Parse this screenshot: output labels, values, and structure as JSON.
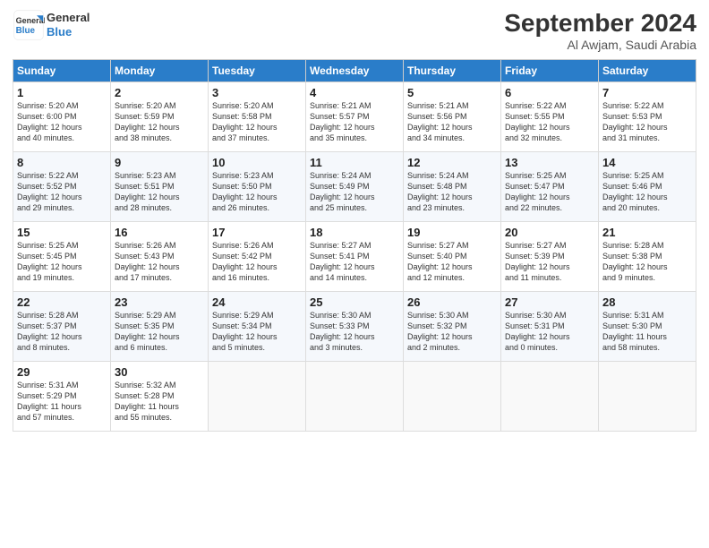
{
  "header": {
    "logo_line1": "General",
    "logo_line2": "Blue",
    "month": "September 2024",
    "location": "Al Awjam, Saudi Arabia"
  },
  "days_of_week": [
    "Sunday",
    "Monday",
    "Tuesday",
    "Wednesday",
    "Thursday",
    "Friday",
    "Saturday"
  ],
  "weeks": [
    [
      {
        "num": "1",
        "lines": [
          "Sunrise: 5:20 AM",
          "Sunset: 6:00 PM",
          "Daylight: 12 hours",
          "and 40 minutes."
        ]
      },
      {
        "num": "2",
        "lines": [
          "Sunrise: 5:20 AM",
          "Sunset: 5:59 PM",
          "Daylight: 12 hours",
          "and 38 minutes."
        ]
      },
      {
        "num": "3",
        "lines": [
          "Sunrise: 5:20 AM",
          "Sunset: 5:58 PM",
          "Daylight: 12 hours",
          "and 37 minutes."
        ]
      },
      {
        "num": "4",
        "lines": [
          "Sunrise: 5:21 AM",
          "Sunset: 5:57 PM",
          "Daylight: 12 hours",
          "and 35 minutes."
        ]
      },
      {
        "num": "5",
        "lines": [
          "Sunrise: 5:21 AM",
          "Sunset: 5:56 PM",
          "Daylight: 12 hours",
          "and 34 minutes."
        ]
      },
      {
        "num": "6",
        "lines": [
          "Sunrise: 5:22 AM",
          "Sunset: 5:55 PM",
          "Daylight: 12 hours",
          "and 32 minutes."
        ]
      },
      {
        "num": "7",
        "lines": [
          "Sunrise: 5:22 AM",
          "Sunset: 5:53 PM",
          "Daylight: 12 hours",
          "and 31 minutes."
        ]
      }
    ],
    [
      {
        "num": "8",
        "lines": [
          "Sunrise: 5:22 AM",
          "Sunset: 5:52 PM",
          "Daylight: 12 hours",
          "and 29 minutes."
        ]
      },
      {
        "num": "9",
        "lines": [
          "Sunrise: 5:23 AM",
          "Sunset: 5:51 PM",
          "Daylight: 12 hours",
          "and 28 minutes."
        ]
      },
      {
        "num": "10",
        "lines": [
          "Sunrise: 5:23 AM",
          "Sunset: 5:50 PM",
          "Daylight: 12 hours",
          "and 26 minutes."
        ]
      },
      {
        "num": "11",
        "lines": [
          "Sunrise: 5:24 AM",
          "Sunset: 5:49 PM",
          "Daylight: 12 hours",
          "and 25 minutes."
        ]
      },
      {
        "num": "12",
        "lines": [
          "Sunrise: 5:24 AM",
          "Sunset: 5:48 PM",
          "Daylight: 12 hours",
          "and 23 minutes."
        ]
      },
      {
        "num": "13",
        "lines": [
          "Sunrise: 5:25 AM",
          "Sunset: 5:47 PM",
          "Daylight: 12 hours",
          "and 22 minutes."
        ]
      },
      {
        "num": "14",
        "lines": [
          "Sunrise: 5:25 AM",
          "Sunset: 5:46 PM",
          "Daylight: 12 hours",
          "and 20 minutes."
        ]
      }
    ],
    [
      {
        "num": "15",
        "lines": [
          "Sunrise: 5:25 AM",
          "Sunset: 5:45 PM",
          "Daylight: 12 hours",
          "and 19 minutes."
        ]
      },
      {
        "num": "16",
        "lines": [
          "Sunrise: 5:26 AM",
          "Sunset: 5:43 PM",
          "Daylight: 12 hours",
          "and 17 minutes."
        ]
      },
      {
        "num": "17",
        "lines": [
          "Sunrise: 5:26 AM",
          "Sunset: 5:42 PM",
          "Daylight: 12 hours",
          "and 16 minutes."
        ]
      },
      {
        "num": "18",
        "lines": [
          "Sunrise: 5:27 AM",
          "Sunset: 5:41 PM",
          "Daylight: 12 hours",
          "and 14 minutes."
        ]
      },
      {
        "num": "19",
        "lines": [
          "Sunrise: 5:27 AM",
          "Sunset: 5:40 PM",
          "Daylight: 12 hours",
          "and 12 minutes."
        ]
      },
      {
        "num": "20",
        "lines": [
          "Sunrise: 5:27 AM",
          "Sunset: 5:39 PM",
          "Daylight: 12 hours",
          "and 11 minutes."
        ]
      },
      {
        "num": "21",
        "lines": [
          "Sunrise: 5:28 AM",
          "Sunset: 5:38 PM",
          "Daylight: 12 hours",
          "and 9 minutes."
        ]
      }
    ],
    [
      {
        "num": "22",
        "lines": [
          "Sunrise: 5:28 AM",
          "Sunset: 5:37 PM",
          "Daylight: 12 hours",
          "and 8 minutes."
        ]
      },
      {
        "num": "23",
        "lines": [
          "Sunrise: 5:29 AM",
          "Sunset: 5:35 PM",
          "Daylight: 12 hours",
          "and 6 minutes."
        ]
      },
      {
        "num": "24",
        "lines": [
          "Sunrise: 5:29 AM",
          "Sunset: 5:34 PM",
          "Daylight: 12 hours",
          "and 5 minutes."
        ]
      },
      {
        "num": "25",
        "lines": [
          "Sunrise: 5:30 AM",
          "Sunset: 5:33 PM",
          "Daylight: 12 hours",
          "and 3 minutes."
        ]
      },
      {
        "num": "26",
        "lines": [
          "Sunrise: 5:30 AM",
          "Sunset: 5:32 PM",
          "Daylight: 12 hours",
          "and 2 minutes."
        ]
      },
      {
        "num": "27",
        "lines": [
          "Sunrise: 5:30 AM",
          "Sunset: 5:31 PM",
          "Daylight: 12 hours",
          "and 0 minutes."
        ]
      },
      {
        "num": "28",
        "lines": [
          "Sunrise: 5:31 AM",
          "Sunset: 5:30 PM",
          "Daylight: 11 hours",
          "and 58 minutes."
        ]
      }
    ],
    [
      {
        "num": "29",
        "lines": [
          "Sunrise: 5:31 AM",
          "Sunset: 5:29 PM",
          "Daylight: 11 hours",
          "and 57 minutes."
        ]
      },
      {
        "num": "30",
        "lines": [
          "Sunrise: 5:32 AM",
          "Sunset: 5:28 PM",
          "Daylight: 11 hours",
          "and 55 minutes."
        ]
      },
      {
        "num": "",
        "lines": []
      },
      {
        "num": "",
        "lines": []
      },
      {
        "num": "",
        "lines": []
      },
      {
        "num": "",
        "lines": []
      },
      {
        "num": "",
        "lines": []
      }
    ]
  ]
}
